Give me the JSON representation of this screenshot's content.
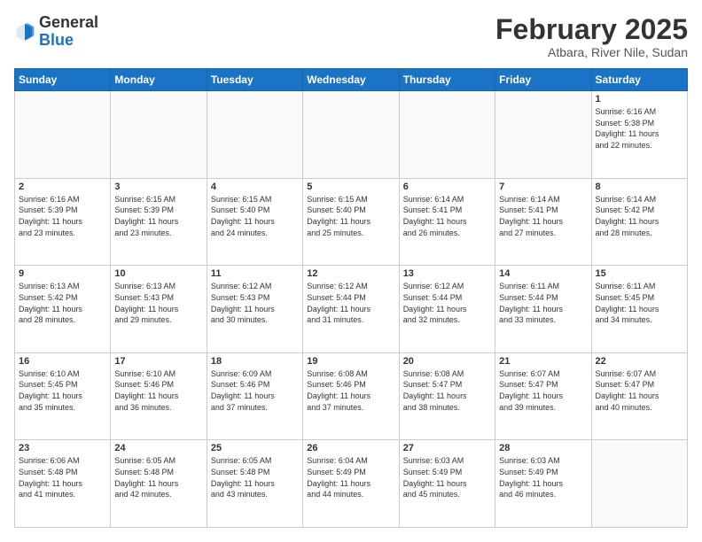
{
  "header": {
    "logo_general": "General",
    "logo_blue": "Blue",
    "month_title": "February 2025",
    "location": "Atbara, River Nile, Sudan"
  },
  "weekdays": [
    "Sunday",
    "Monday",
    "Tuesday",
    "Wednesday",
    "Thursday",
    "Friday",
    "Saturday"
  ],
  "weeks": [
    [
      {
        "day": "",
        "info": ""
      },
      {
        "day": "",
        "info": ""
      },
      {
        "day": "",
        "info": ""
      },
      {
        "day": "",
        "info": ""
      },
      {
        "day": "",
        "info": ""
      },
      {
        "day": "",
        "info": ""
      },
      {
        "day": "1",
        "info": "Sunrise: 6:16 AM\nSunset: 5:38 PM\nDaylight: 11 hours\nand 22 minutes."
      }
    ],
    [
      {
        "day": "2",
        "info": "Sunrise: 6:16 AM\nSunset: 5:39 PM\nDaylight: 11 hours\nand 23 minutes."
      },
      {
        "day": "3",
        "info": "Sunrise: 6:15 AM\nSunset: 5:39 PM\nDaylight: 11 hours\nand 23 minutes."
      },
      {
        "day": "4",
        "info": "Sunrise: 6:15 AM\nSunset: 5:40 PM\nDaylight: 11 hours\nand 24 minutes."
      },
      {
        "day": "5",
        "info": "Sunrise: 6:15 AM\nSunset: 5:40 PM\nDaylight: 11 hours\nand 25 minutes."
      },
      {
        "day": "6",
        "info": "Sunrise: 6:14 AM\nSunset: 5:41 PM\nDaylight: 11 hours\nand 26 minutes."
      },
      {
        "day": "7",
        "info": "Sunrise: 6:14 AM\nSunset: 5:41 PM\nDaylight: 11 hours\nand 27 minutes."
      },
      {
        "day": "8",
        "info": "Sunrise: 6:14 AM\nSunset: 5:42 PM\nDaylight: 11 hours\nand 28 minutes."
      }
    ],
    [
      {
        "day": "9",
        "info": "Sunrise: 6:13 AM\nSunset: 5:42 PM\nDaylight: 11 hours\nand 28 minutes."
      },
      {
        "day": "10",
        "info": "Sunrise: 6:13 AM\nSunset: 5:43 PM\nDaylight: 11 hours\nand 29 minutes."
      },
      {
        "day": "11",
        "info": "Sunrise: 6:12 AM\nSunset: 5:43 PM\nDaylight: 11 hours\nand 30 minutes."
      },
      {
        "day": "12",
        "info": "Sunrise: 6:12 AM\nSunset: 5:44 PM\nDaylight: 11 hours\nand 31 minutes."
      },
      {
        "day": "13",
        "info": "Sunrise: 6:12 AM\nSunset: 5:44 PM\nDaylight: 11 hours\nand 32 minutes."
      },
      {
        "day": "14",
        "info": "Sunrise: 6:11 AM\nSunset: 5:44 PM\nDaylight: 11 hours\nand 33 minutes."
      },
      {
        "day": "15",
        "info": "Sunrise: 6:11 AM\nSunset: 5:45 PM\nDaylight: 11 hours\nand 34 minutes."
      }
    ],
    [
      {
        "day": "16",
        "info": "Sunrise: 6:10 AM\nSunset: 5:45 PM\nDaylight: 11 hours\nand 35 minutes."
      },
      {
        "day": "17",
        "info": "Sunrise: 6:10 AM\nSunset: 5:46 PM\nDaylight: 11 hours\nand 36 minutes."
      },
      {
        "day": "18",
        "info": "Sunrise: 6:09 AM\nSunset: 5:46 PM\nDaylight: 11 hours\nand 37 minutes."
      },
      {
        "day": "19",
        "info": "Sunrise: 6:08 AM\nSunset: 5:46 PM\nDaylight: 11 hours\nand 37 minutes."
      },
      {
        "day": "20",
        "info": "Sunrise: 6:08 AM\nSunset: 5:47 PM\nDaylight: 11 hours\nand 38 minutes."
      },
      {
        "day": "21",
        "info": "Sunrise: 6:07 AM\nSunset: 5:47 PM\nDaylight: 11 hours\nand 39 minutes."
      },
      {
        "day": "22",
        "info": "Sunrise: 6:07 AM\nSunset: 5:47 PM\nDaylight: 11 hours\nand 40 minutes."
      }
    ],
    [
      {
        "day": "23",
        "info": "Sunrise: 6:06 AM\nSunset: 5:48 PM\nDaylight: 11 hours\nand 41 minutes."
      },
      {
        "day": "24",
        "info": "Sunrise: 6:05 AM\nSunset: 5:48 PM\nDaylight: 11 hours\nand 42 minutes."
      },
      {
        "day": "25",
        "info": "Sunrise: 6:05 AM\nSunset: 5:48 PM\nDaylight: 11 hours\nand 43 minutes."
      },
      {
        "day": "26",
        "info": "Sunrise: 6:04 AM\nSunset: 5:49 PM\nDaylight: 11 hours\nand 44 minutes."
      },
      {
        "day": "27",
        "info": "Sunrise: 6:03 AM\nSunset: 5:49 PM\nDaylight: 11 hours\nand 45 minutes."
      },
      {
        "day": "28",
        "info": "Sunrise: 6:03 AM\nSunset: 5:49 PM\nDaylight: 11 hours\nand 46 minutes."
      },
      {
        "day": "",
        "info": ""
      }
    ]
  ]
}
